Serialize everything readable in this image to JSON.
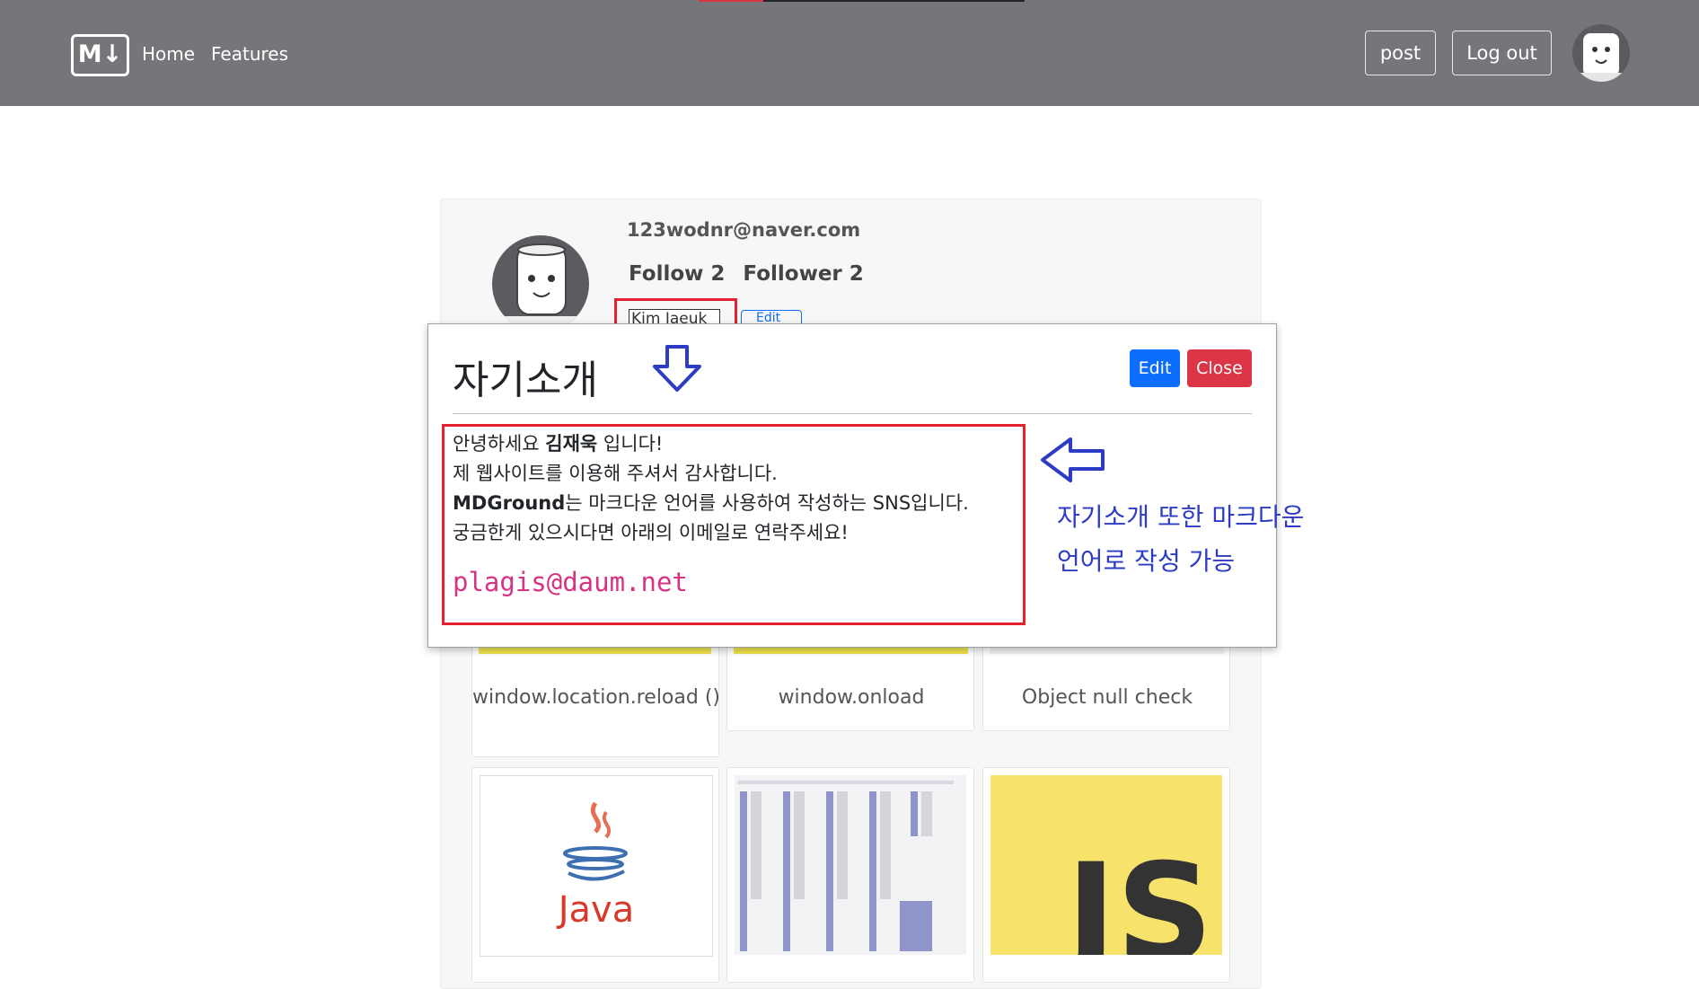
{
  "navbar": {
    "brand": "M↓",
    "links": [
      "Home",
      "Features"
    ],
    "post_label": "post",
    "logout_label": "Log out"
  },
  "profile": {
    "email": "123wodnr@naver.com",
    "follow_label": "Follow 2",
    "follower_label": "Follower 2",
    "name": "Kim Jaeuk",
    "edit_label": "Edit"
  },
  "posts": [
    {
      "title": "window.location.reload ()"
    },
    {
      "title": "window.onload"
    },
    {
      "title": "Object null check"
    },
    {
      "title": ""
    },
    {
      "title": ""
    },
    {
      "title": ""
    }
  ],
  "modal": {
    "title": "자기소개",
    "edit_label": "Edit",
    "close_label": "Close",
    "greeting_pre": "안녕하세요 ",
    "greeting_name": "김재욱",
    "greeting_post": " 입니다!",
    "line2": "제 웹사이트를 이용해 주셔서 감사합니다.",
    "line3_bold": "MDGround",
    "line3_rest": "는 마크다운 언어를 사용하여 작성하는 SNS입니다.",
    "line4": "궁금한게 있으시다면 아래의 이메일로 연락주세요!",
    "email": "plagis@daum.net"
  },
  "annotation": {
    "line1": "자기소개 또한 마크다운",
    "line2": "언어로 작성 가능"
  },
  "thumb_text": {
    "java": "Java",
    "js": "JS"
  },
  "colors": {
    "navbar": "#76767a",
    "primary": "#0d6efd",
    "danger": "#dc3545",
    "annotation": "#2c3cc4",
    "highlight": "#e5202f",
    "code": "#d63384"
  }
}
